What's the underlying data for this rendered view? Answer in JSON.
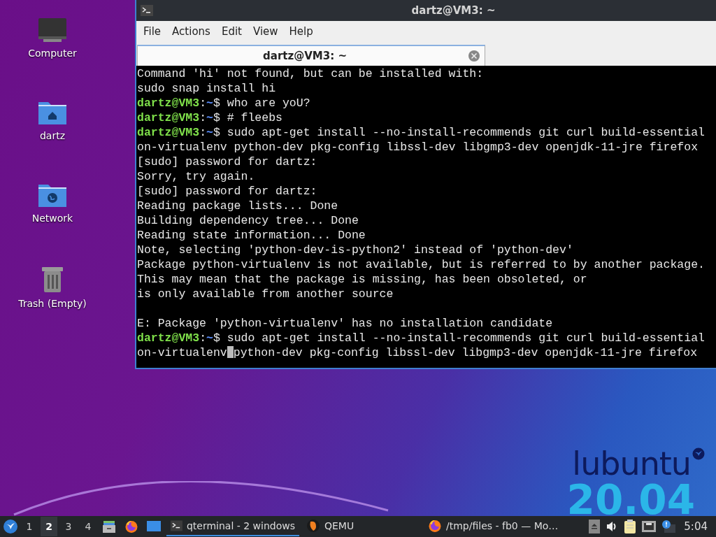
{
  "desktop_icons": [
    {
      "label": "Computer",
      "kind": "computer"
    },
    {
      "label": "dartz",
      "kind": "home"
    },
    {
      "label": "Network",
      "kind": "network"
    },
    {
      "label": "Trash (Empty)",
      "kind": "trash"
    }
  ],
  "wallpaper": {
    "brand": "lubuntu",
    "version": "20.04"
  },
  "window": {
    "title": "dartz@VM3: ~",
    "menu": [
      "File",
      "Actions",
      "Edit",
      "View",
      "Help"
    ],
    "tabs": [
      {
        "label": "dartz@VM3: ~",
        "selected": true
      }
    ],
    "lines": [
      [
        {
          "kind": "plain",
          "text": "Command 'hi' not found, but can be installed with:"
        }
      ],
      [
        {
          "kind": "plain",
          "text": "sudo snap install hi"
        }
      ],
      [
        {
          "kind": "user",
          "text": "dartz@VM3"
        },
        {
          "kind": "plain",
          "text": ":"
        },
        {
          "kind": "path",
          "text": "~"
        },
        {
          "kind": "plain",
          "text": "$ who are yoU?"
        }
      ],
      [
        {
          "kind": "user",
          "text": "dartz@VM3"
        },
        {
          "kind": "plain",
          "text": ":"
        },
        {
          "kind": "path",
          "text": "~"
        },
        {
          "kind": "plain",
          "text": "$ # fleebs"
        }
      ],
      [
        {
          "kind": "user",
          "text": "dartz@VM3"
        },
        {
          "kind": "plain",
          "text": ":"
        },
        {
          "kind": "path",
          "text": "~"
        },
        {
          "kind": "plain",
          "text": "$ sudo apt-get install --no-install-recommends git curl build-essential"
        }
      ],
      [
        {
          "kind": "plain",
          "text": "on-virtualenv python-dev pkg-config libssl-dev libgmp3-dev openjdk-11-jre firefox"
        }
      ],
      [
        {
          "kind": "plain",
          "text": "[sudo] password for dartz:"
        }
      ],
      [
        {
          "kind": "plain",
          "text": "Sorry, try again."
        }
      ],
      [
        {
          "kind": "plain",
          "text": "[sudo] password for dartz:"
        }
      ],
      [
        {
          "kind": "plain",
          "text": "Reading package lists... Done"
        }
      ],
      [
        {
          "kind": "plain",
          "text": "Building dependency tree... Done"
        }
      ],
      [
        {
          "kind": "plain",
          "text": "Reading state information... Done"
        }
      ],
      [
        {
          "kind": "plain",
          "text": "Note, selecting 'python-dev-is-python2' instead of 'python-dev'"
        }
      ],
      [
        {
          "kind": "plain",
          "text": "Package python-virtualenv is not available, but is referred to by another package."
        }
      ],
      [
        {
          "kind": "plain",
          "text": "This may mean that the package is missing, has been obsoleted, or"
        }
      ],
      [
        {
          "kind": "plain",
          "text": "is only available from another source"
        }
      ],
      [
        {
          "kind": "blank"
        }
      ],
      [
        {
          "kind": "plain",
          "text": "E: Package 'python-virtualenv' has no installation candidate"
        }
      ],
      [
        {
          "kind": "user",
          "text": "dartz@VM3"
        },
        {
          "kind": "plain",
          "text": ":"
        },
        {
          "kind": "path",
          "text": "~"
        },
        {
          "kind": "plain",
          "text": "$ sudo apt-get install --no-install-recommends git curl build-essential"
        }
      ],
      [
        {
          "kind": "plain",
          "text": "on-virtualenv"
        },
        {
          "kind": "cursor"
        },
        {
          "kind": "plain",
          "text": "python-dev pkg-config libssl-dev libgmp3-dev openjdk-11-jre firefox"
        }
      ]
    ]
  },
  "taskbar": {
    "workspaces": [
      {
        "label": "1",
        "selected": false
      },
      {
        "label": "2",
        "selected": true
      },
      {
        "label": "3",
        "selected": false
      },
      {
        "label": "4",
        "selected": false
      }
    ],
    "launchers": [
      {
        "kind": "files"
      },
      {
        "kind": "firefox"
      },
      {
        "kind": "desktop"
      }
    ],
    "tasks": [
      {
        "label": "qterminal - 2 windows",
        "kind": "terminal",
        "selected": true
      },
      {
        "label": "QEMU",
        "kind": "qemu",
        "selected": false
      },
      {
        "label": "/tmp/files - fb0 — Mo…",
        "kind": "firefox",
        "selected": false
      }
    ],
    "tray": [
      {
        "kind": "eject"
      },
      {
        "kind": "volume"
      },
      {
        "kind": "clipboard"
      },
      {
        "kind": "network"
      },
      {
        "kind": "notification"
      }
    ],
    "clock": "5:04"
  }
}
